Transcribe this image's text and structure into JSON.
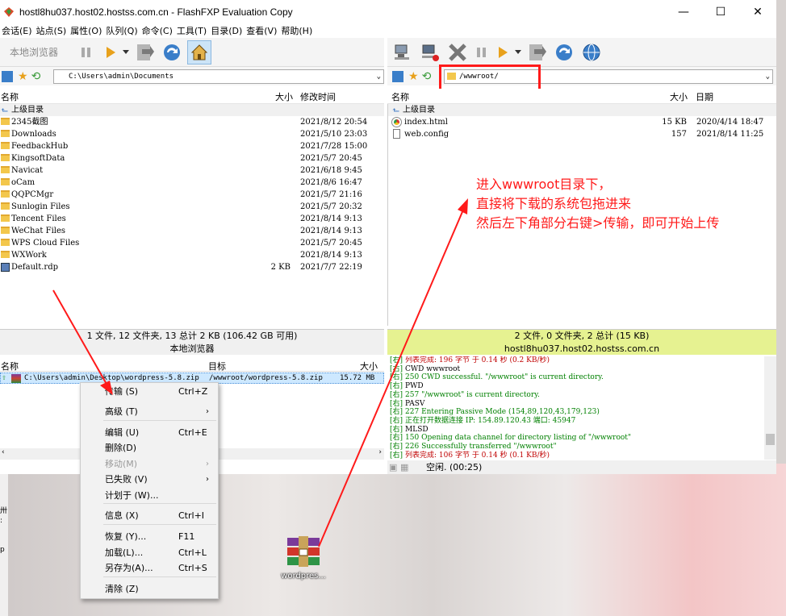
{
  "window": {
    "title": "hostl8hu037.host02.hostss.com.cn - FlashFXP Evaluation Copy",
    "controls": [
      "—",
      "☐",
      "✕"
    ]
  },
  "menu": [
    "会话(E)",
    "站点(S)",
    "属性(O)",
    "队列(Q)",
    "命令(C)",
    "工具(T)",
    "目录(D)",
    "查看(V)",
    "帮助(H)"
  ],
  "local": {
    "browser_label": "本地浏览器",
    "path": "C:\\Users\\admin\\Documents",
    "columns": {
      "name": "名称",
      "size": "大小",
      "date": "修改时间"
    },
    "up_label": "上级目录",
    "files": [
      {
        "name": "2345截图",
        "size": "",
        "date": "2021/8/12 20:54"
      },
      {
        "name": "Downloads",
        "size": "",
        "date": "2021/5/10 23:03"
      },
      {
        "name": "FeedbackHub",
        "size": "",
        "date": "2021/7/28 15:00"
      },
      {
        "name": "KingsoftData",
        "size": "",
        "date": "2021/5/7 20:45"
      },
      {
        "name": "Navicat",
        "size": "",
        "date": "2021/6/18 9:45"
      },
      {
        "name": "oCam",
        "size": "",
        "date": "2021/8/6 16:47"
      },
      {
        "name": "QQPCMgr",
        "size": "",
        "date": "2021/5/7 21:16"
      },
      {
        "name": "Sunlogin Files",
        "size": "",
        "date": "2021/5/7 20:32"
      },
      {
        "name": "Tencent Files",
        "size": "",
        "date": "2021/8/14 9:13"
      },
      {
        "name": "WeChat Files",
        "size": "",
        "date": "2021/8/14 9:13"
      },
      {
        "name": "WPS Cloud Files",
        "size": "",
        "date": "2021/5/7 20:45"
      },
      {
        "name": "WXWork",
        "size": "",
        "date": "2021/8/14 9:13"
      },
      {
        "name": "Default.rdp",
        "size": "2 KB",
        "date": "2021/7/7 22:19"
      }
    ],
    "status1": "1 文件, 12 文件夹, 13 总计 2 KB (106.42 GB 可用)",
    "status2": "本地浏览器"
  },
  "remote": {
    "path": "/wwwroot/",
    "columns": {
      "name": "名称",
      "size": "大小",
      "date": "日期"
    },
    "up_label": "上级目录",
    "files": [
      {
        "name": "index.html",
        "size": "15 KB",
        "date": "2020/4/14 18:47"
      },
      {
        "name": "web.config",
        "size": "157",
        "date": "2021/8/14 11:25"
      }
    ],
    "status1": "2 文件, 0 文件夹, 2 总计 (15 KB)",
    "status2": "hostl8hu037.host02.hostss.com.cn",
    "status_color": "#e6f291"
  },
  "queue": {
    "columns": {
      "name": "名称",
      "target": "目标",
      "size": "大小"
    },
    "item": {
      "name": "C:\\Users\\admin\\Desktop\\wordpress-5.8.zip",
      "target": "/wwwroot/wordpress-5.8.zip",
      "size": "15.72 MB"
    },
    "idle": "空闲. (00:25)"
  },
  "log": [
    {
      "tag": "[右]",
      "text": "列表完成: 196 字节 于 0.14 秒 (0.2 KB/秒)",
      "c": "r"
    },
    {
      "tag": "[右]",
      "text": "CWD wwwroot",
      "c": "b"
    },
    {
      "tag": "[右]",
      "text": "250 CWD successful. \"/wwwroot\" is current directory.",
      "c": "g"
    },
    {
      "tag": "[右]",
      "text": "PWD",
      "c": "b"
    },
    {
      "tag": "[右]",
      "text": "257 \"/wwwroot\" is current directory.",
      "c": "g"
    },
    {
      "tag": "[右]",
      "text": "PASV",
      "c": "b"
    },
    {
      "tag": "[右]",
      "text": "227 Entering Passive Mode (154,89,120,43,179,123)",
      "c": "g"
    },
    {
      "tag": "[右]",
      "text": "正在打开数据连接 IP: 154.89.120.43 端口: 45947",
      "c": "g"
    },
    {
      "tag": "[右]",
      "text": "MLSD",
      "c": "b"
    },
    {
      "tag": "[右]",
      "text": "150 Opening data channel for directory listing of \"/wwwroot\"",
      "c": "g"
    },
    {
      "tag": "[右]",
      "text": "226 Successfully transferred \"/wwwroot\"",
      "c": "g"
    },
    {
      "tag": "[右]",
      "text": "列表完成: 106 字节 于 0.14 秒 (0.1 KB/秒)",
      "c": "r"
    }
  ],
  "context_menu": [
    {
      "label": "传输 (S)",
      "shortcut": "Ctrl+Z",
      "arrow": "",
      "disabled": false
    },
    {
      "label": "高级 (T)",
      "shortcut": "",
      "arrow": "›",
      "disabled": false
    },
    {
      "label": "编辑 (U)",
      "shortcut": "Ctrl+E",
      "arrow": "",
      "disabled": false
    },
    {
      "label": "删除(D)",
      "shortcut": "",
      "arrow": "",
      "disabled": false
    },
    {
      "label": "移动(M)",
      "shortcut": "",
      "arrow": "›",
      "disabled": true
    },
    {
      "label": "已失败 (V)",
      "shortcut": "",
      "arrow": "›",
      "disabled": false
    },
    {
      "label": "计划于 (W)...",
      "shortcut": "",
      "arrow": "",
      "disabled": false
    },
    {
      "label": "信息 (X)",
      "shortcut": "Ctrl+I",
      "arrow": "",
      "disabled": false
    },
    {
      "label": "恢复 (Y)...",
      "shortcut": "F11",
      "arrow": "",
      "disabled": false
    },
    {
      "label": "加载(L)...",
      "shortcut": "Ctrl+L",
      "arrow": "",
      "disabled": false
    },
    {
      "label": "另存为(A)...",
      "shortcut": "Ctrl+S",
      "arrow": "",
      "disabled": false
    },
    {
      "label": "清除 (Z)",
      "shortcut": "",
      "arrow": "",
      "disabled": false
    }
  ],
  "desktop": {
    "icon_label": "wordpres..."
  },
  "annotation": {
    "lines": [
      "进入wwwroot目录下，",
      "直接将下载的系统包拖进来",
      "然后左下角部分右键>传输，即可开始上传"
    ],
    "color": "#ff1a1a"
  }
}
